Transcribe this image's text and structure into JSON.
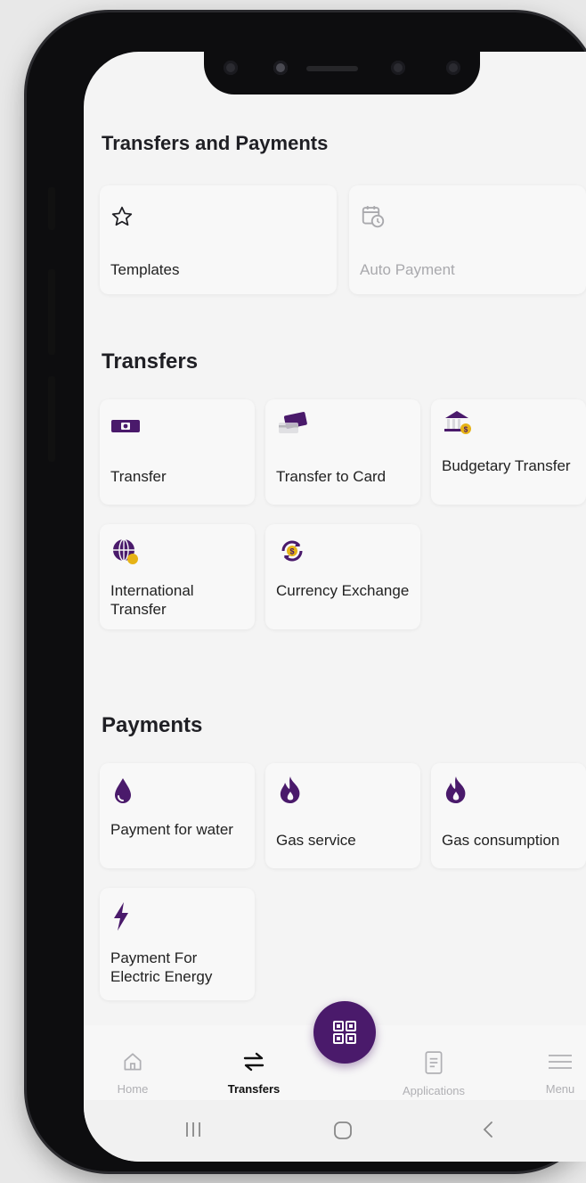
{
  "colors": {
    "accent": "#4a1a6b",
    "gold": "#e6b316",
    "text": "#1f1f24",
    "muted": "#a9a9ad"
  },
  "sections": {
    "transfers_payments": {
      "title": "Transfers and Payments",
      "items": [
        {
          "label": "Templates",
          "icon": "star-icon",
          "enabled": true
        },
        {
          "label": "Auto Payment",
          "icon": "calendar-clock-icon",
          "enabled": false
        }
      ]
    },
    "transfers": {
      "title": "Transfers",
      "items": [
        {
          "label": "Transfer",
          "icon": "cash-icon"
        },
        {
          "label": "Transfer to Card",
          "icon": "card-icon"
        },
        {
          "label": "Budgetary Transfer",
          "icon": "bank-icon"
        },
        {
          "label": "International Transfer",
          "icon": "globe-icon"
        },
        {
          "label": "Currency Exchange",
          "icon": "currency-exchange-icon"
        }
      ]
    },
    "payments": {
      "title": "Payments",
      "items": [
        {
          "label": "Payment for water",
          "icon": "water-drop-icon"
        },
        {
          "label": "Gas service",
          "icon": "flame-icon"
        },
        {
          "label": "Gas consumption",
          "icon": "flame-icon"
        },
        {
          "label": "Payment For Electric Energy",
          "icon": "lightning-icon"
        }
      ]
    }
  },
  "nav": {
    "items": [
      {
        "label": "Home",
        "icon": "home-icon",
        "active": false
      },
      {
        "label": "Transfers",
        "icon": "transfer-arrows-icon",
        "active": true
      },
      {
        "label": "Applications",
        "icon": "document-icon",
        "active": false
      },
      {
        "label": "Menu",
        "icon": "hamburger-icon",
        "active": false
      }
    ],
    "fab_icon": "qr-code-icon"
  },
  "system_nav": [
    "recent-apps-icon",
    "home-circle-icon",
    "back-icon"
  ]
}
